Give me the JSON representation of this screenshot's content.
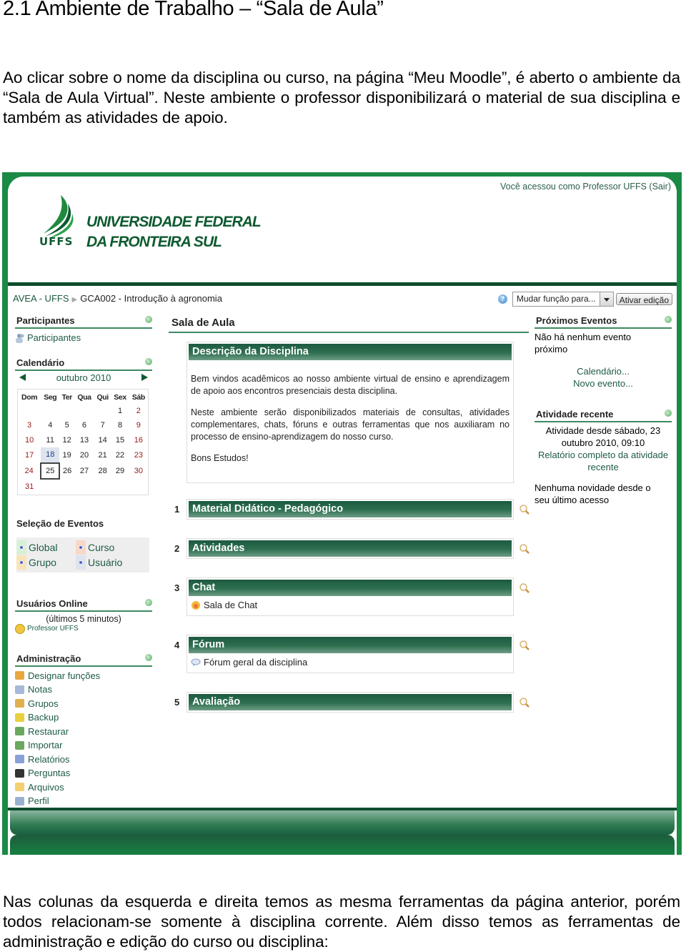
{
  "document": {
    "title": "2.1 Ambiente de Trabalho – “Sala de Aula”",
    "intro": "Ao clicar sobre o nome da disciplina ou curso, na página “Meu Moodle”, é aberto o ambiente da “Sala de Aula Virtual”. Neste ambiente o professor disponibilizará o material de sua disciplina e também as atividades de apoio.",
    "outro": "Nas colunas da esquerda e direita temos as mesma ferramentas da página anterior, porém todos relacionam-se somente à disciplina corrente. Além disso temos as ferramentas de administração e edição do curso ou disciplina:"
  },
  "screenshot": {
    "colors": {
      "frame": "#1a8a44",
      "dark_green": "#0e4d2c",
      "link": "#1d5b45"
    },
    "header": {
      "logo_abbr": "UFFS",
      "logo_line1": "UNIVERSIDADE FEDERAL",
      "logo_line2": "DA FRONTEIRA SUL",
      "login_info": "Você acessou como Professor UFFS (Sair)"
    },
    "navbar": {
      "breadcrumb_home": "AVEA - UFFS",
      "breadcrumb_current": "GCA002 - Introdução à agronomia",
      "role_select_value": "Mudar função para...",
      "edit_button": "Ativar edição",
      "help_icon": "?"
    },
    "left": {
      "participants": {
        "title": "Participantes",
        "link": "Participantes"
      },
      "calendar": {
        "title": "Calendário",
        "month": "outubro 2010",
        "weekdays": [
          "Dom",
          "Seg",
          "Ter",
          "Qua",
          "Qui",
          "Sex",
          "Sáb"
        ],
        "weeks": [
          [
            "",
            "",
            "",
            "",
            "",
            "1",
            "2"
          ],
          [
            "3",
            "4",
            "5",
            "6",
            "7",
            "8",
            "9"
          ],
          [
            "10",
            "11",
            "12",
            "13",
            "14",
            "15",
            "16"
          ],
          [
            "17",
            "18",
            "19",
            "20",
            "21",
            "22",
            "23"
          ],
          [
            "24",
            "25",
            "26",
            "27",
            "28",
            "29",
            "30"
          ],
          [
            "31",
            "",
            "",
            "",
            "",
            "",
            ""
          ]
        ],
        "today": "25",
        "highlighted": "18"
      },
      "event_selection": {
        "title": "Seleção de Eventos",
        "items": [
          {
            "label": "Global",
            "color": "#d8f0d8"
          },
          {
            "label": "Curso",
            "color": "#f8d8c8"
          },
          {
            "label": "Grupo",
            "color": "#f8e4b8"
          },
          {
            "label": "Usuário",
            "color": "#dde4ee"
          }
        ]
      },
      "online_users": {
        "title": "Usuários Online",
        "subtitle": "(últimos 5 minutos)",
        "user": "Professor UFFS"
      },
      "administration": {
        "title": "Administração",
        "items": [
          {
            "label": "Designar funções",
            "icon": "roles-icon"
          },
          {
            "label": "Notas",
            "icon": "grades-icon"
          },
          {
            "label": "Grupos",
            "icon": "groups-icon"
          },
          {
            "label": "Backup",
            "icon": "backup-icon"
          },
          {
            "label": "Restaurar",
            "icon": "restore-icon"
          },
          {
            "label": "Importar",
            "icon": "import-icon"
          },
          {
            "label": "Relatórios",
            "icon": "reports-icon"
          },
          {
            "label": "Perguntas",
            "icon": "questions-icon"
          },
          {
            "label": "Arquivos",
            "icon": "folder-icon"
          },
          {
            "label": "Perfil",
            "icon": "profile-icon"
          }
        ]
      }
    },
    "main": {
      "title": "Sala de Aula",
      "description": {
        "heading": "Descrição da Disciplina",
        "paragraphs": [
          "Bem vindos acadêmicos ao nosso ambiente virtual de ensino e aprendizagem de apoio aos encontros presenciais desta disciplina.",
          "Neste ambiente serão disponibilizados materiais de consultas, atividades complementares, chats, fóruns e outras ferramentas que nos auxiliaram no processo de ensino-aprendizagem do nosso curso.",
          "Bons Estudos!"
        ]
      },
      "sections": [
        {
          "num": "1",
          "title": "Material Didático - Pedagógico",
          "activity": ""
        },
        {
          "num": "2",
          "title": "Atividades",
          "activity": ""
        },
        {
          "num": "3",
          "title": "Chat",
          "activity": "Sala de Chat"
        },
        {
          "num": "4",
          "title": "Fórum",
          "activity": "Fórum geral da disciplina"
        },
        {
          "num": "5",
          "title": "Avaliação",
          "activity": ""
        }
      ]
    },
    "right": {
      "upcoming": {
        "title": "Próximos Eventos",
        "empty": "Não há nenhum evento próximo",
        "calendar_link": "Calendário...",
        "new_event_link": "Novo evento..."
      },
      "recent": {
        "title": "Atividade recente",
        "since": "Atividade desde sábado, 23 outubro 2010, 09:10",
        "report_link": "Relatório completo da atividade recente",
        "none": "Nenhuma novidade desde o seu último acesso"
      }
    }
  }
}
